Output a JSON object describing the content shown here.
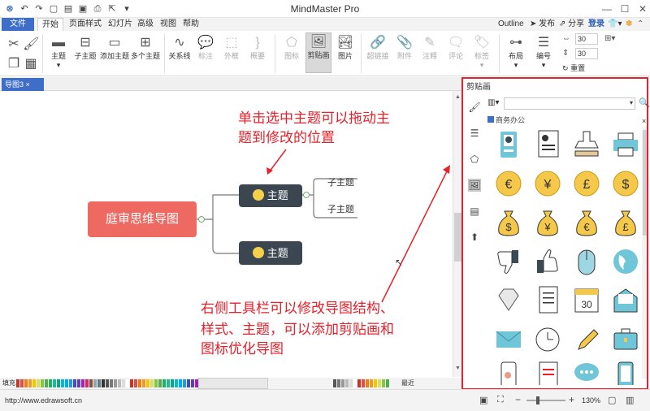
{
  "app": {
    "title": "MindMaster Pro"
  },
  "quick_access": {
    "undo": "↶",
    "redo": "↷"
  },
  "window_controls": {
    "minimize": "—",
    "maximize": "☐",
    "close": "✕"
  },
  "menu": {
    "tabs": [
      "文件",
      "开始",
      "页面样式",
      "幻灯片",
      "高级",
      "视图",
      "帮助"
    ],
    "right": {
      "outline": "Outline",
      "publish": "发布",
      "share": "分享",
      "login": "登录"
    }
  },
  "ribbon": {
    "groups": [
      {
        "label": "主题",
        "icon": "topic-icon"
      },
      {
        "label": "子主题",
        "icon": "subtopic-icon"
      },
      {
        "label": "添加主题",
        "icon": "add-topic-icon"
      },
      {
        "label": "多个主题",
        "icon": "multiple-topic-icon"
      },
      {
        "label": "关系线",
        "icon": "relationship-icon"
      },
      {
        "label": "标注",
        "icon": "callout-icon"
      },
      {
        "label": "外框",
        "icon": "boundary-icon"
      },
      {
        "label": "概要",
        "icon": "summary-icon"
      },
      {
        "label": "图标",
        "icon": "mark-icon"
      },
      {
        "label": "剪贴画",
        "icon": "clipart-icon"
      },
      {
        "label": "图片",
        "icon": "picture-icon"
      },
      {
        "label": "超链接",
        "icon": "hyperlink-icon"
      },
      {
        "label": "附件",
        "icon": "attachment-icon"
      },
      {
        "label": "注释",
        "icon": "note-icon"
      },
      {
        "label": "评论",
        "icon": "comment-icon"
      },
      {
        "label": "标签",
        "icon": "tag-icon"
      },
      {
        "label": "布局",
        "icon": "layout-icon"
      },
      {
        "label": "编号",
        "icon": "numbering-icon"
      }
    ],
    "spin1": "30",
    "spin2": "30",
    "reset": "重置"
  },
  "doc_tab": {
    "label": "导图3",
    "close": "×"
  },
  "mindmap": {
    "central": "庭审思维导图",
    "topic1": "主题",
    "topic2": "主题",
    "sub1": "子主题",
    "sub2": "子主题"
  },
  "annotations": {
    "top_line1": "单击选中主题可以拖动主",
    "top_line2": "题到修改的位置",
    "bottom_line1": "右侧工具栏可以修改导图结构、",
    "bottom_line2": "样式、主题，可以添加剪贴画和",
    "bottom_line3": "图标优化导图"
  },
  "sidebar": {
    "title": "剪贴画",
    "category": "商务办公",
    "search_placeholder": "",
    "clips_row5_calendar": "30"
  },
  "palette": {
    "fill_label": "填充",
    "recent_label": "最近"
  },
  "status": {
    "url": "http://www.edrawsoft.cn",
    "zoom": "130%"
  },
  "colors": {
    "accent": "#3e6ec8",
    "central": "#ee6962",
    "topic": "#3b4650",
    "annotation": "#e8202a"
  }
}
